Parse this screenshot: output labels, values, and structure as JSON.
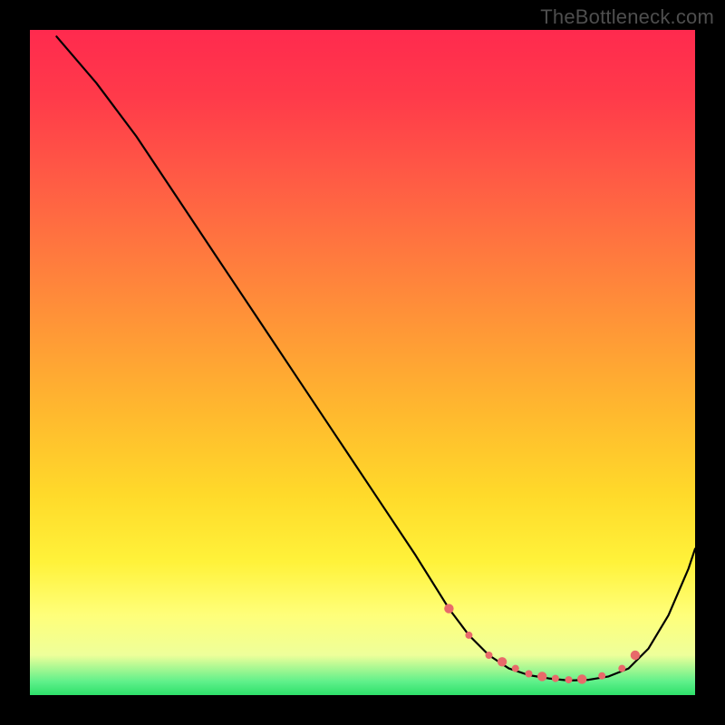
{
  "watermark": "TheBottleneck.com",
  "colors": {
    "page_bg": "#000000",
    "marker_fill": "#e86a6a",
    "curve_stroke": "#000000"
  },
  "chart_data": {
    "type": "line",
    "title": "",
    "xlabel": "",
    "ylabel": "",
    "xlim": [
      0,
      100
    ],
    "ylim": [
      0,
      100
    ],
    "grid": false,
    "legend": false,
    "series": [
      {
        "name": "bottleneck-curve",
        "x": [
          4,
          10,
          16,
          22,
          28,
          34,
          40,
          46,
          52,
          58,
          63,
          66,
          69,
          72,
          75,
          78,
          81,
          84,
          87,
          90,
          93,
          96,
          99,
          100
        ],
        "values": [
          99,
          92,
          84,
          75,
          66,
          57,
          48,
          39,
          30,
          21,
          13,
          9,
          6,
          4,
          3,
          2.5,
          2.2,
          2.3,
          2.8,
          4,
          7,
          12,
          19,
          22
        ]
      }
    ],
    "markers": {
      "name": "optimum-region-markers",
      "x": [
        63,
        66,
        69,
        71,
        73,
        75,
        77,
        79,
        81,
        83,
        86,
        89,
        91
      ],
      "values": [
        13,
        9,
        6,
        5,
        4,
        3.2,
        2.8,
        2.5,
        2.3,
        2.4,
        2.9,
        4,
        6
      ]
    }
  }
}
